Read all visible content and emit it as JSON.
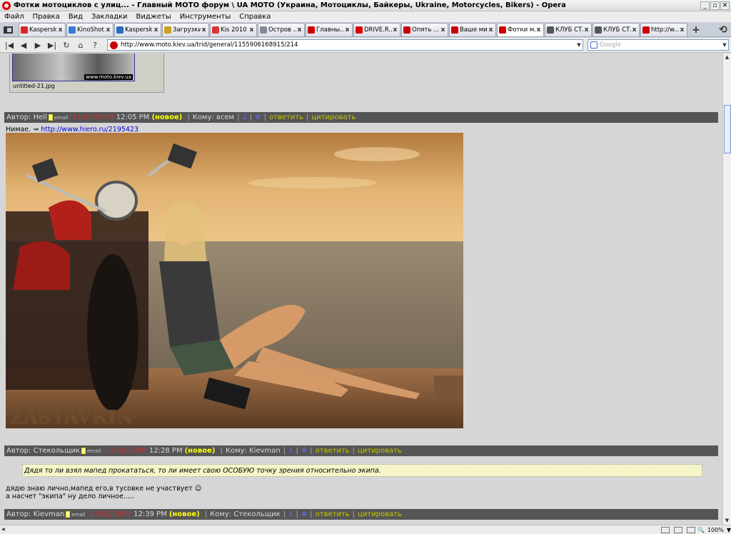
{
  "window": {
    "title": "Фотки мотоциклов с улиц... - Главный МОТО форум \\ UA MOTO (Украина, Мотоциклы, Байкеры, Ukraine, Motorcycles, Bikers) - Opera",
    "min": "_",
    "max": "▫",
    "close": "✕"
  },
  "menu": [
    "Файл",
    "Правка",
    "Вид",
    "Закладки",
    "Виджеты",
    "Инструменты",
    "Справка"
  ],
  "tabs": [
    {
      "label": "Kaspersk...",
      "color": "#d22"
    },
    {
      "label": "KinoShot...",
      "color": "#3a7bd5"
    },
    {
      "label": "Kaspersk...",
      "color": "#2a6cc0"
    },
    {
      "label": "Загрузки",
      "color": "#c9a020"
    },
    {
      "label": "Kis 2010 ...",
      "color": "#d33"
    },
    {
      "label": "Остров ...",
      "color": "#889"
    },
    {
      "label": "Главны...",
      "color": "#c00"
    },
    {
      "label": "DRIVE.R...",
      "color": "#d00"
    },
    {
      "label": "Опять ...",
      "color": "#c00"
    },
    {
      "label": "Ваше ми...",
      "color": "#c00"
    },
    {
      "label": "Фотки м...",
      "color": "#c00",
      "active": true
    },
    {
      "label": "КЛУБ СТ...",
      "color": "#555"
    },
    {
      "label": "КЛУБ СТ...",
      "color": "#555"
    },
    {
      "label": "http://w...",
      "color": "#c00"
    }
  ],
  "tab_close": "x",
  "tab_add": "+",
  "address": {
    "url": "http://www.moto.kiev.ua/trid/general/1155906168915/214",
    "search_placeholder": "Google"
  },
  "prev_post": {
    "watermark": "www.moto.kiev.ua",
    "filename": "untitled-21.jpg"
  },
  "posts": [
    {
      "author_label": "Автор:",
      "author": "Hell",
      "email": "email",
      "date": "11/02/2009",
      "time": "12:05 PM",
      "new": "(новое)",
      "to_label": "Кому:",
      "to": "всем",
      "num": "1",
      "hash": "#",
      "reply": "ответить",
      "quote": "цитировать"
    },
    {
      "author_label": "Автор:",
      "author": "Стекольщик",
      "email": "email",
      "date": "11/02/2009",
      "time": "12:28 PM",
      "new": "(новое)",
      "to_label": "Кому:",
      "to": "Kievman",
      "num": "1",
      "hash": "#",
      "reply": "ответить",
      "quote": "цитировать"
    },
    {
      "author_label": "Автор:",
      "author": "Kievman",
      "email": "email",
      "date": "11/02/2009",
      "time": "12:39 PM",
      "new": "(новое)",
      "to_label": "Кому:",
      "to": "Стекольщик",
      "num": "1",
      "hash": "#",
      "reply": "ответить",
      "quote": "цитировать"
    }
  ],
  "post1_text": "Нимае.",
  "post1_link": "http://www.hiero.ru/2195423",
  "photo_watermark": "ZASTAVKIN",
  "quote_text": "Дядя то ли взял мапед прокататься, то ли имеет свою ОСОБУЮ точку зрения относительно экипа.",
  "post2_line1": "дядю знаю лично,мапед его,в тусовке не участвует",
  "post2_line2": "а насчет \"экипа\" ну дело личное.....",
  "status": {
    "zoom": "100%"
  }
}
